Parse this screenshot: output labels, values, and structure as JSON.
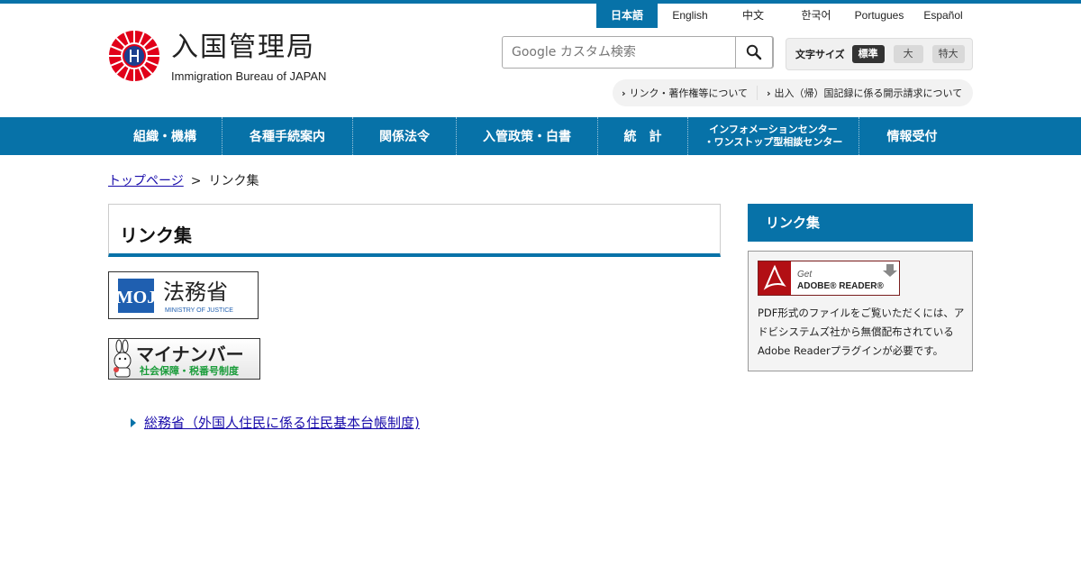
{
  "header": {
    "logo_ja": "入国管理局",
    "logo_en": "Immigration Bureau of JAPAN",
    "languages": [
      {
        "label": "日本語",
        "active": true
      },
      {
        "label": "English",
        "active": false
      },
      {
        "label": "中文",
        "active": false
      },
      {
        "label": "한국어",
        "active": false
      },
      {
        "label": "Portugues",
        "active": false
      },
      {
        "label": "Español",
        "active": false
      }
    ],
    "search_placeholder": "Google カスタム検索",
    "fontsize": {
      "label": "文字サイズ",
      "options": [
        {
          "label": "標準",
          "active": true
        },
        {
          "label": "大",
          "active": false
        },
        {
          "label": "特大",
          "active": false
        }
      ]
    },
    "sublinks": [
      "リンク・著作権等について",
      "出入（帰）国記録に係る開示請求について"
    ]
  },
  "nav": {
    "items": [
      {
        "label": "組織・機構"
      },
      {
        "label": "各種手続案内"
      },
      {
        "label": "関係法令"
      },
      {
        "label": "入管政策・白書"
      },
      {
        "label": "統　計"
      },
      {
        "line1": "インフォメーションセンター",
        "line2": "・ワンストップ型相談センター"
      },
      {
        "label": "情報受付"
      }
    ]
  },
  "breadcrumb": {
    "home": "トップページ",
    "separator": ">",
    "current": "リンク集"
  },
  "main": {
    "title": "リンク集",
    "banners": {
      "moj_ja": "法務省",
      "moj_en": "MINISTRY OF JUSTICE",
      "moj_mark": "MOJ",
      "mynumber_title": "マイナンバー",
      "mynumber_sub": "社会保障・税番号制度"
    },
    "links": [
      "総務省（外国人住民に係る住民基本台帳制度)"
    ]
  },
  "sidebar": {
    "title": "リンク集",
    "adobe_get": "Get",
    "adobe_label": "ADOBE® READER®",
    "text": "PDF形式のファイルをご覧いただくには、アドビシステムズ社から無償配布されているAdobe Readerプラグインが必要です。"
  },
  "colors": {
    "brand": "#0772a8",
    "link": "#1a0dab"
  }
}
